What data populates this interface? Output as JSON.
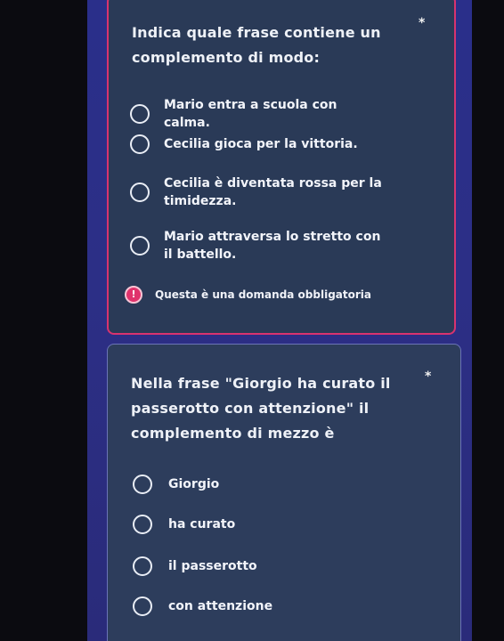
{
  "questions": [
    {
      "text": "Indica quale frase contiene un complemento di modo:",
      "required_mark": "*",
      "options": [
        {
          "label": "Mario entra a scuola con calma."
        },
        {
          "label": "Cecilia gioca per la vittoria."
        },
        {
          "label": "Cecilia è diventata rossa per la timidezza."
        },
        {
          "label": "Mario attraversa lo stretto con il battello."
        }
      ],
      "error": {
        "icon": "!",
        "text": "Questa è una domanda obbligatoria"
      }
    },
    {
      "text": "Nella frase \"Giorgio ha curato il passerotto con attenzione\" il complemento di mezzo è",
      "required_mark": "*",
      "options": [
        {
          "label": "Giorgio"
        },
        {
          "label": "ha curato"
        },
        {
          "label": "il passerotto"
        },
        {
          "label": "con attenzione"
        }
      ]
    }
  ],
  "colors": {
    "background": "#2a2f8a",
    "card": "#2a3a57",
    "error_accent": "#d8336f"
  }
}
